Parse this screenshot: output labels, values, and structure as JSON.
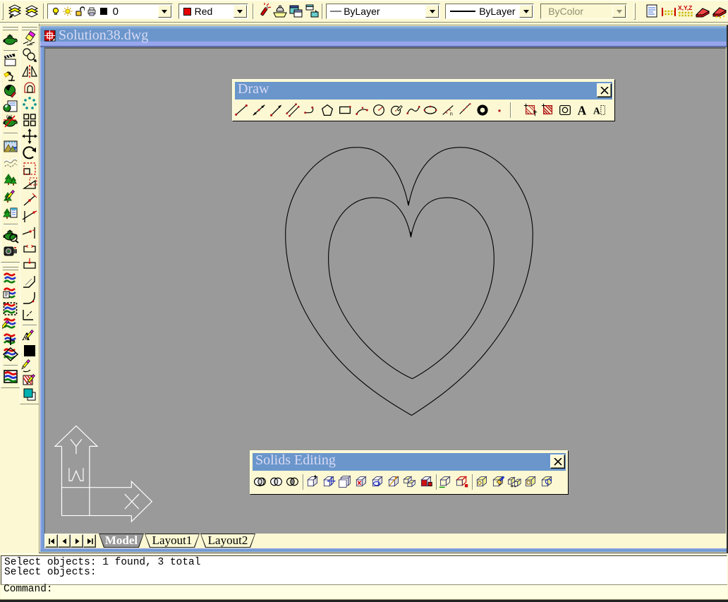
{
  "document_window": {
    "title": "Solution38.dwg"
  },
  "top_toolbar": {
    "layer_buttons": [
      {
        "name": "make-objects-layer-current",
        "icon": "layers-current"
      },
      {
        "name": "layers",
        "icon": "layers"
      }
    ],
    "layer_combo": {
      "value": "0",
      "state_icons": [
        "bulb",
        "sun",
        "unlock",
        "printer",
        "swatch-black"
      ]
    },
    "color_combo": {
      "value": "Red",
      "swatch_color": "#e80000"
    },
    "property_buttons": [
      {
        "name": "match-properties",
        "icon": "match-props"
      },
      {
        "name": "object-snap-settings",
        "icon": "snap-dome"
      },
      {
        "name": "designcenter",
        "icon": "designcenter"
      },
      {
        "name": "properties-window",
        "icon": "prop-window"
      }
    ],
    "linetype_combo": {
      "value": "ByLayer"
    },
    "lineweight_combo": {
      "value": "ByLayer"
    },
    "plotstyle_combo": {
      "value": "ByColor",
      "disabled": true
    },
    "inquiry_buttons": [
      {
        "name": "list",
        "icon": "list"
      },
      {
        "name": "distance",
        "icon": "distance"
      },
      {
        "name": "locate-point",
        "icon": "locate-point"
      },
      {
        "name": "area",
        "icon": "area"
      },
      {
        "name": "mass-properties",
        "icon": "mass-props"
      }
    ]
  },
  "render_toolbar": {
    "items": [
      {
        "name": "render",
        "icon": "render"
      },
      {
        "sep": true
      },
      {
        "name": "scenes",
        "icon": "scenes"
      },
      {
        "name": "lights",
        "icon": "lights"
      },
      {
        "name": "materials",
        "icon": "materials"
      },
      {
        "name": "materials-library",
        "icon": "materials-library"
      },
      {
        "name": "hide",
        "icon": "hide"
      },
      {
        "sep": true
      },
      {
        "name": "mapping",
        "icon": "mapping"
      },
      {
        "name": "background",
        "icon": "background"
      },
      {
        "name": "landscape-new",
        "icon": "landscape-new"
      },
      {
        "name": "landscape-edit",
        "icon": "landscape-edit"
      },
      {
        "name": "landscape-library",
        "icon": "landscape-library"
      },
      {
        "sep": true
      },
      {
        "name": "render-preferences",
        "icon": "render-preferences"
      },
      {
        "name": "statistics",
        "icon": "statistics"
      }
    ]
  },
  "shade_toolbar": {
    "items": [
      {
        "name": "2d-wireframe",
        "icon": "shade-2dwire"
      },
      {
        "name": "3d-wireframe",
        "icon": "shade-3dwire"
      },
      {
        "name": "hidden",
        "icon": "shade-hidden"
      },
      {
        "name": "flat-shaded",
        "icon": "shade-flat"
      },
      {
        "name": "gouraud-shaded",
        "icon": "shade-gouraud"
      },
      {
        "name": "flat-shaded-edges-on",
        "icon": "shade-flat-edges"
      },
      {
        "sep": true
      },
      {
        "name": "gouraud-shaded-edges-on",
        "icon": "shade-gouraud-edges"
      }
    ]
  },
  "modify_toolbar": {
    "items": [
      {
        "name": "erase",
        "icon": "erase"
      },
      {
        "name": "copy-object",
        "icon": "copy"
      },
      {
        "name": "mirror",
        "icon": "mirror"
      },
      {
        "name": "offset",
        "icon": "offset"
      },
      {
        "name": "array-polar",
        "icon": "array-polar"
      },
      {
        "name": "array-rectangular",
        "icon": "array-rect"
      },
      {
        "name": "move",
        "icon": "move"
      },
      {
        "name": "rotate",
        "icon": "rotate"
      },
      {
        "name": "scale",
        "icon": "scale"
      },
      {
        "name": "stretch",
        "icon": "stretch"
      },
      {
        "name": "lengthen",
        "icon": "lengthen"
      },
      {
        "name": "trim",
        "icon": "trim"
      },
      {
        "name": "extend",
        "icon": "extend"
      },
      {
        "name": "break",
        "icon": "break"
      },
      {
        "name": "break-at-point",
        "icon": "break-at-point"
      },
      {
        "name": "chamfer",
        "icon": "chamfer"
      },
      {
        "name": "fillet",
        "icon": "fillet"
      },
      {
        "name": "explode",
        "icon": "explode"
      },
      {
        "sep": true
      },
      {
        "name": "edit-text",
        "icon": "edit-text"
      },
      {
        "name": "edit-color",
        "icon": "swatch-black-lg"
      },
      {
        "name": "edit-polyline",
        "icon": "pedit"
      },
      {
        "name": "edit-hatch",
        "icon": "hatch-edit"
      },
      {
        "name": "draworder",
        "icon": "draworder"
      }
    ]
  },
  "draw_toolbar": {
    "title": "Draw",
    "close_label": "close",
    "items": [
      {
        "name": "line",
        "icon": "draw-line"
      },
      {
        "name": "construction-line",
        "icon": "xline"
      },
      {
        "name": "ray",
        "icon": "ray"
      },
      {
        "name": "multiline",
        "icon": "mline"
      },
      {
        "name": "polyline",
        "icon": "pline"
      },
      {
        "name": "polygon",
        "icon": "polygon"
      },
      {
        "name": "rectangle",
        "icon": "rectangle"
      },
      {
        "name": "arc",
        "icon": "arc"
      },
      {
        "name": "circle",
        "icon": "circle"
      },
      {
        "name": "revision-cloud",
        "icon": "revcloud"
      },
      {
        "name": "spline",
        "icon": "spline"
      },
      {
        "name": "ellipse",
        "icon": "ellipse"
      },
      {
        "name": "divide",
        "icon": "divide"
      },
      {
        "name": "measure",
        "icon": "measure"
      },
      {
        "name": "donut",
        "icon": "donut"
      },
      {
        "name": "point",
        "icon": "point"
      },
      {
        "sep": true
      },
      {
        "name": "hatch",
        "icon": "hatch"
      },
      {
        "name": "boundary",
        "icon": "boundary"
      },
      {
        "name": "region",
        "icon": "region"
      },
      {
        "name": "single-line-text",
        "icon": "text-a"
      },
      {
        "name": "multiline-text",
        "icon": "mtext"
      }
    ]
  },
  "solids_toolbar": {
    "title": "Solids Editing",
    "close_label": "close",
    "items": [
      {
        "name": "union",
        "icon": "union"
      },
      {
        "name": "subtract",
        "icon": "subtract"
      },
      {
        "name": "intersect",
        "icon": "intersect"
      },
      {
        "sep": true
      },
      {
        "name": "extrude-faces",
        "icon": "extrude-faces"
      },
      {
        "name": "move-faces",
        "icon": "move-faces"
      },
      {
        "name": "offset-faces",
        "icon": "offset-faces"
      },
      {
        "name": "delete-faces",
        "icon": "delete-faces"
      },
      {
        "name": "rotate-faces",
        "icon": "rotate-faces"
      },
      {
        "name": "taper-faces",
        "icon": "taper-faces"
      },
      {
        "name": "copy-faces",
        "icon": "copy-faces"
      },
      {
        "name": "color-faces",
        "icon": "color-faces"
      },
      {
        "sep": true
      },
      {
        "name": "copy-edges",
        "icon": "copy-edges"
      },
      {
        "name": "color-edges",
        "icon": "color-edges"
      },
      {
        "sep": true
      },
      {
        "name": "imprint",
        "icon": "imprint"
      },
      {
        "name": "clean",
        "icon": "clean"
      },
      {
        "name": "separate",
        "icon": "separate"
      },
      {
        "name": "shell",
        "icon": "shell"
      },
      {
        "name": "check",
        "icon": "check"
      }
    ]
  },
  "layout_tabs": {
    "nav_buttons": [
      {
        "name": "first-tab",
        "icon": "nav-first"
      },
      {
        "name": "previous-tab",
        "icon": "nav-prev"
      },
      {
        "name": "next-tab",
        "icon": "nav-next"
      },
      {
        "name": "last-tab",
        "icon": "nav-last"
      }
    ],
    "tabs": [
      {
        "label": "Model",
        "active": true
      },
      {
        "label": "Layout1",
        "active": false
      },
      {
        "label": "Layout2",
        "active": false
      }
    ]
  },
  "command_window": {
    "history": [
      "Select objects: 1 found, 3 total",
      "Select objects:"
    ],
    "prompt": "Command:"
  },
  "drawing": {
    "description": "two concentric heart-shaped closed curves",
    "ucs_icon": "world-ucs-icon"
  },
  "colors": {
    "chrome_face": "#fbf8d3",
    "title_blue": "#6a96cb",
    "canvas_gray": "#9a9a9a",
    "title_text": "#d9daf5"
  }
}
